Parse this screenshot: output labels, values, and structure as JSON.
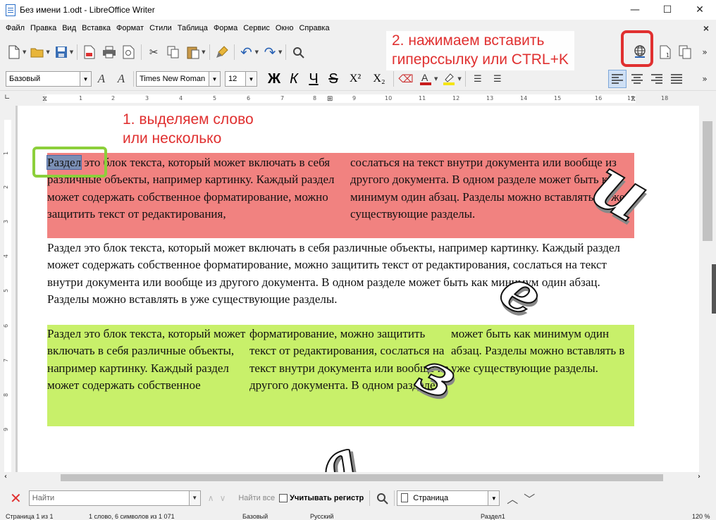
{
  "window": {
    "title": "Без имени 1.odt - LibreOffice Writer",
    "minimize": "—",
    "maximize": "☐",
    "close": "✕"
  },
  "menu": {
    "items": [
      "Файл",
      "Правка",
      "Вид",
      "Вставка",
      "Формат",
      "Стили",
      "Таблица",
      "Форма",
      "Сервис",
      "Окно",
      "Справка"
    ],
    "close": "×"
  },
  "format_bar": {
    "paragraph_style": "Базовый",
    "font_name": "Times New Roman",
    "font_size": "12",
    "bold": "Ж",
    "italic": "К",
    "underline": "Ч",
    "strike": "S",
    "superscript": "X²",
    "subscript": "X₂"
  },
  "ruler": {
    "numbers": [
      "1",
      "2",
      "3",
      "4",
      "5",
      "6",
      "7",
      "8",
      "9",
      "10",
      "11",
      "12",
      "13",
      "14",
      "15",
      "16",
      "17",
      "18"
    ],
    "vnumbers": [
      "1",
      "2",
      "3",
      "4",
      "5",
      "6",
      "7",
      "8",
      "9"
    ]
  },
  "document": {
    "selected_word": "Раздел",
    "section1_col1": " это блок текста, который может включать в себя различные объекты, например картинку. Каждый раздел может содержать собственное форматирование, можно защитить текст от редактирования,",
    "section1_col2": "сослаться на текст внутри документа или вообще из другого документа. В одном разделе может быть как минимум один абзац. Разделы можно вставлять в уже существующие разделы.",
    "section2": "Раздел это блок текста, который может включать в себя различные объекты, например картинку. Каждый раздел может содержать собственное форматирование, можно защитить текст от редактирования, сослаться на текст внутри документа или вообще из другого документа. В одном разделе может быть как минимум один абзац. Разделы можно вставлять в уже существующие разделы.",
    "section3_col1": "Раздел это блок текста, который может включать в себя различные объекты, например картинку. Каждый раздел может содержать собственное",
    "section3_col2": "форматирование, можно защитить текст от редактирования, сослаться на текст внутри документа или вообще из другого документа. В одном разделе",
    "section3_col3": "может быть как минимум один абзац. Разделы можно вставлять в уже существующие разделы."
  },
  "decorations": {
    "d1": "и",
    "d2": "е",
    "d3": "з",
    "d4": "а"
  },
  "annotations": {
    "step1_line1": "1. выделяем слово",
    "step1_line2": "или несколько",
    "step2_line1": "2. нажимаем вставить",
    "step2_line2": "гиперссылку или CTRL+K"
  },
  "findbar": {
    "placeholder": "Найти",
    "find_all": "Найти все",
    "match_case": "Учитывать регистр",
    "search_type": "Страница"
  },
  "status": {
    "page": "Страница 1 из 1",
    "words": "1 слово, 6 символов из 1 071",
    "style": "Базовый",
    "language": "Русский",
    "section": "Раздел1",
    "zoom": "120 %"
  },
  "colors": {
    "section1": "#f18280",
    "section3": "#c8f06a",
    "annotation": "#e03030",
    "highlight_box": "#8ccf3a"
  }
}
